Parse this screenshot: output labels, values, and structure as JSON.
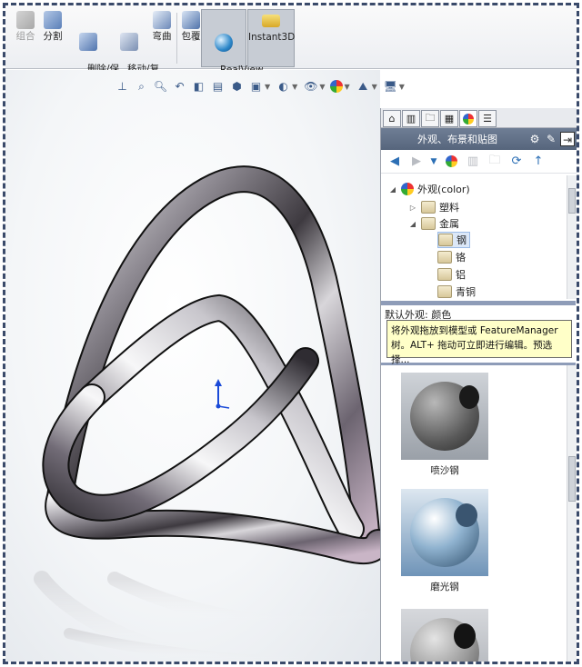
{
  "ribbon": {
    "buttons": [
      {
        "label": "组合",
        "icon": "combine-icon",
        "disabled": true
      },
      {
        "label": "分割",
        "icon": "split-icon"
      },
      {
        "label": "删除/保\n留实体",
        "icon": "delete-keep-body-icon"
      },
      {
        "label": "移动/复\n制实体",
        "icon": "move-copy-body-icon"
      },
      {
        "label": "弯曲",
        "icon": "flex-icon"
      },
      {
        "label": "包覆",
        "icon": "wrap-icon"
      },
      {
        "label": "RealView\n图形",
        "icon": "realview-icon",
        "pressed": true
      },
      {
        "label": "Instant3D",
        "icon": "instant3d-icon",
        "pressed": true
      }
    ]
  },
  "heads_up_toolbar": [
    "view-orientation-icon",
    "zoom-to-fit-icon",
    "zoom-area-icon",
    "previous-view-icon",
    "section-view-icon",
    "dynamic-annotation-icon",
    "display-style-icon",
    "hide-show-icon",
    "edit-appearance-icon",
    "apply-scene-icon",
    "view-settings-icon"
  ],
  "task_pane": {
    "title": "外观、布景和贴图",
    "tree": {
      "root": "外观(color)",
      "children": [
        {
          "label": "塑料"
        },
        {
          "label": "金属",
          "children": [
            "钢",
            "铬",
            "铝",
            "青铜"
          ]
        }
      ],
      "selected": "钢"
    },
    "default_appearance": "默认外观: 颜色",
    "tooltip": "将外观拖放到模型或 FeatureManager 树。ALT+ 拖动可立即进行编辑。预选择...",
    "gallery": [
      {
        "label": "喷沙钢"
      },
      {
        "label": "磨光钢"
      },
      {
        "label": ""
      }
    ]
  },
  "colors": {
    "pane_title_bg": "#5f6e85",
    "tooltip_bg": "#ffffc8",
    "triad_blue": "#1a4ad8"
  }
}
